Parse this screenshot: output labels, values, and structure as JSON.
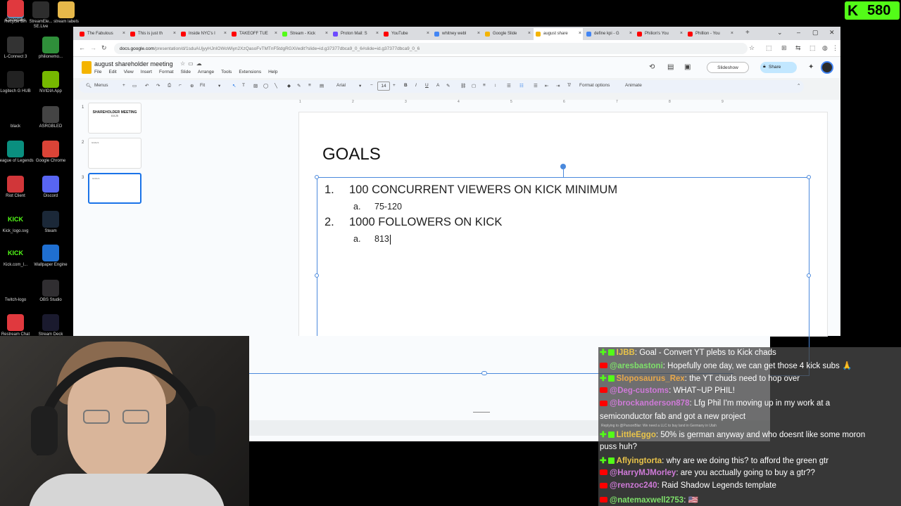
{
  "desktop": {
    "icons": [
      {
        "label": "Recycle Bin",
        "color": "#5f8fb8"
      },
      {
        "label": "StreamEle... SE.Live",
        "color": "#2d2d2d"
      },
      {
        "label": "stream labels",
        "color": "#e6b84a"
      },
      {
        "label": "L-Connect 3",
        "color": "#333333"
      },
      {
        "label": "philionemo...",
        "color": "#2f8f3a"
      },
      {
        "label": "Logitech G HUB",
        "color": "#222222"
      },
      {
        "label": "NVIDIA App",
        "color": "#76b900"
      },
      {
        "label": "black",
        "color": "#000000"
      },
      {
        "label": "ASRGBLED",
        "color": "#444444"
      },
      {
        "label": "League of Legends",
        "color": "#0a8f7f"
      },
      {
        "label": "Google Chrome",
        "color": "#db4437"
      },
      {
        "label": "Riot Client",
        "color": "#d13639"
      },
      {
        "label": "Discord",
        "color": "#5865f2"
      },
      {
        "label": "Kick_logo.svg",
        "color": "#000000"
      },
      {
        "label": "Steam",
        "color": "#1b2838"
      },
      {
        "label": "Kick.com_l...",
        "color": "#000000"
      },
      {
        "label": "Wallpaper Engine",
        "color": "#1f6fd1"
      },
      {
        "label": "Twitch-logo",
        "color": "#000000"
      },
      {
        "label": "OBS Studio",
        "color": "#302e31"
      },
      {
        "label": "Restream Chat",
        "color": "#e0393e"
      },
      {
        "label": "Stream Deck",
        "color": "#1a1a2e"
      },
      {
        "label": "Casterlabs",
        "color": "#e0393e"
      }
    ],
    "kick_icon_text": "KICK"
  },
  "browser": {
    "tabs": [
      {
        "label": "The Fabulous",
        "color": "#ff0000"
      },
      {
        "label": "This is just th",
        "color": "#ff0000"
      },
      {
        "label": "Inside NYC's I",
        "color": "#ff0000"
      },
      {
        "label": "TAKEOFF TUE",
        "color": "#ff0000"
      },
      {
        "label": "Stream - Kick",
        "color": "#53fc18"
      },
      {
        "label": "Proton Mail: S",
        "color": "#6d4aff"
      },
      {
        "label": "YouTube",
        "color": "#ff0000"
      },
      {
        "label": "whitney webl",
        "color": "#4285f4"
      },
      {
        "label": "Google Slide",
        "color": "#f4b400"
      },
      {
        "label": "august share",
        "color": "#f4b400"
      },
      {
        "label": "define kpi - G",
        "color": "#4285f4"
      },
      {
        "label": "Philion's You",
        "color": "#ff0000"
      },
      {
        "label": "Phillion - You",
        "color": "#ff0000"
      }
    ],
    "url_host": "docs.google.com",
    "url_path": "/presentation/d/1sduAUjyyHJnIOWoWiyn2XzQasoFvTMTnF5tdgRGXI/edit?slide=id.g37377dbca9_0_6#slide=id.g37377dbca9_0_6"
  },
  "docs": {
    "title": "august shareholder meeting",
    "menus": [
      "File",
      "Edit",
      "View",
      "Insert",
      "Format",
      "Slide",
      "Arrange",
      "Tools",
      "Extensions",
      "Help"
    ],
    "slideshow_label": "Slideshow",
    "share_label": "Share",
    "toolbar": {
      "menus_label": "Menus",
      "zoom_label": "Fit",
      "font_label": "Arial",
      "font_size": "14",
      "format_options_label": "Format options",
      "animate_label": "Animate"
    },
    "thumbnails": [
      {
        "num": "1",
        "title": "SHAREHOLDER MEETING",
        "sub": "8.8.25"
      },
      {
        "num": "2",
        "text": "GOALS"
      },
      {
        "num": "3",
        "text": "GOALS"
      }
    ],
    "ruler_marks": [
      "1",
      "2",
      "3",
      "4",
      "5",
      "6",
      "7",
      "8",
      "9"
    ]
  },
  "slide": {
    "title": "GOALS",
    "items": [
      {
        "marker": "1.",
        "text": "100 CONCURRENT VIEWERS ON KICK MINIMUM",
        "sub_marker": "a.",
        "sub_text": "75-120"
      },
      {
        "marker": "2.",
        "text": "1000 FOLLOWERS ON KICK",
        "sub_marker": "a.",
        "sub_text": "813"
      }
    ]
  },
  "kick_overlay": {
    "k": "K",
    "count": "580"
  },
  "chat": {
    "messages": [
      {
        "platform": "kick",
        "user": "IJBB",
        "user_color": "#e8c34a",
        "text": "Goal - Convert YT plebs to Kick chads"
      },
      {
        "platform": "youtube",
        "user": "@aresbastoni",
        "user_color": "#7ee06a",
        "text": "Hopefully one day, we can get those 4 kick subs 🙏"
      },
      {
        "platform": "kick",
        "user": "Sloposaurus_Rex",
        "user_color": "#e8a84a",
        "text": "the YT chuds need to hop over"
      },
      {
        "platform": "youtube",
        "user": "@Deg-customs",
        "user_color": "#cf7ad8",
        "text": "WHAT~UP PHIL!"
      },
      {
        "platform": "youtube",
        "user": "@brockanderson878",
        "user_color": "#cf7ad8",
        "text": "Lfg Phil I'm moving up in my work at a",
        "text2": "semiconductor fab and got a new project"
      },
      {
        "platform": "kick",
        "user": "LittleEggo",
        "user_color": "#e8c34a",
        "reply": "Replying to @ParsonBlar: We need a LLC to buy land in Germany in Utah",
        "text": "50% is german anyway and who doesnt like some moron",
        "text2": "puss huh?"
      },
      {
        "platform": "kick",
        "user": "Aflyingtorta",
        "user_color": "#e8c34a",
        "text": "why are we doing this? to afford the green gtr"
      },
      {
        "platform": "youtube",
        "user": "@HarryMJMorley",
        "user_color": "#cf7ad8",
        "text": "are you acctually going to buy a gtr??"
      },
      {
        "platform": "youtube",
        "user": "@renzoc240",
        "user_color": "#cf7ad8",
        "text": "Raid Shadow Legends template"
      },
      {
        "platform": "youtube",
        "user": "@natemaxwell2753",
        "user_color": "#7ee06a",
        "text": "🇺🇸"
      }
    ]
  }
}
